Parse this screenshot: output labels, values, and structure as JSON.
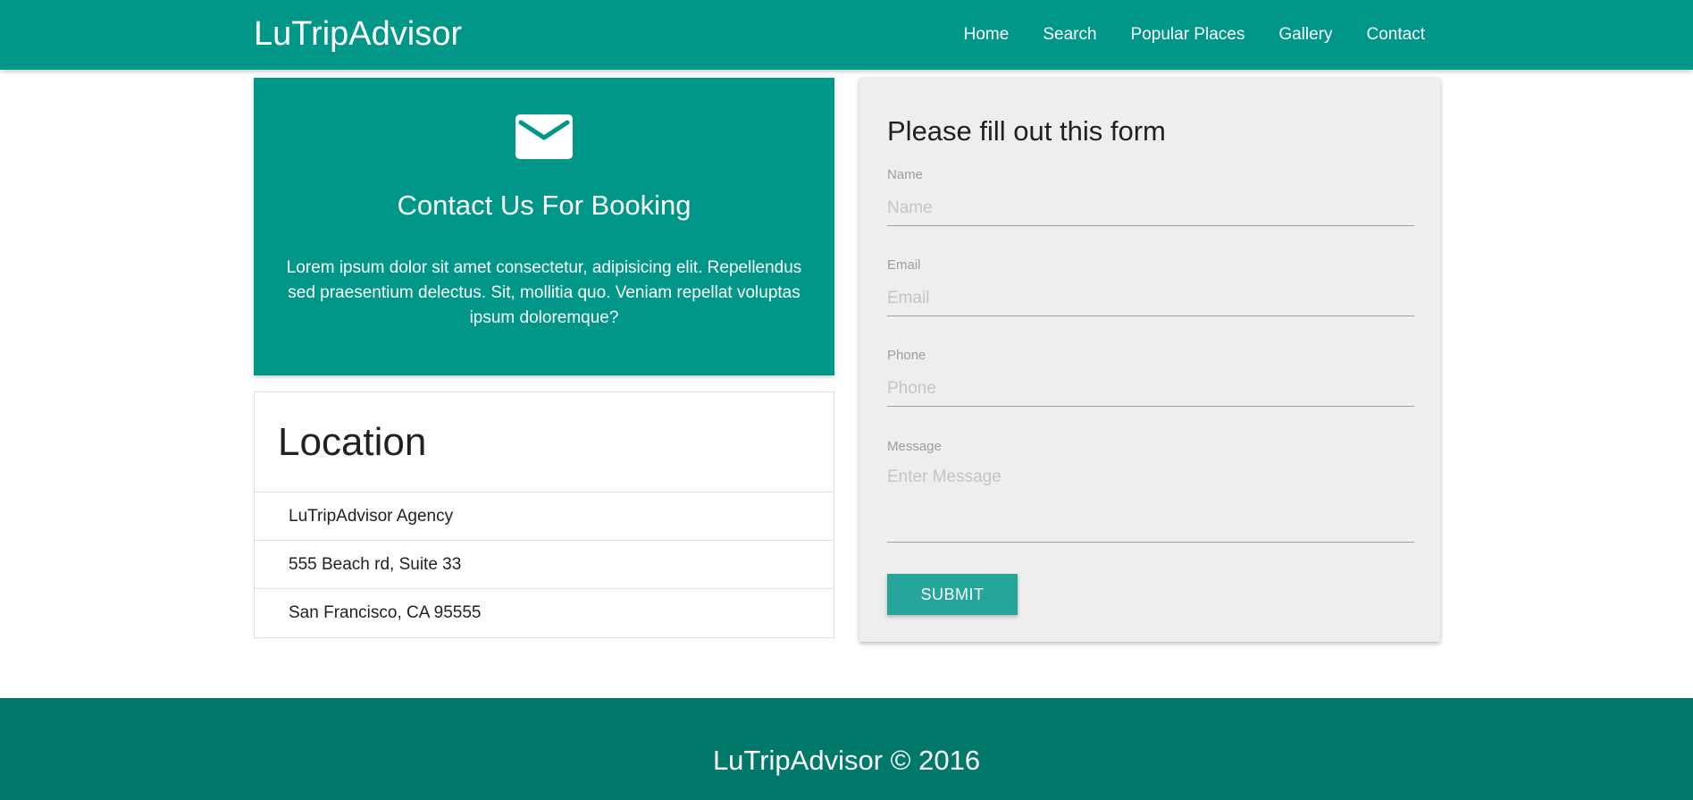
{
  "navbar": {
    "brand": "LuTripAdvisor",
    "links": [
      "Home",
      "Search",
      "Popular Places",
      "Gallery",
      "Contact"
    ]
  },
  "contact_card": {
    "icon": "envelope-icon",
    "title": "Contact Us For Booking",
    "text": "Lorem ipsum dolor sit amet consectetur, adipisicing elit. Repellendus sed praesentium delectus. Sit, mollitia quo. Veniam repellat voluptas ipsum doloremque?"
  },
  "location": {
    "title": "Location",
    "items": [
      "LuTripAdvisor Agency",
      "555 Beach rd, Suite 33",
      "San Francisco, CA 95555"
    ]
  },
  "form": {
    "title": "Please fill out this form",
    "fields": [
      {
        "label": "Name",
        "placeholder": "Name",
        "value": ""
      },
      {
        "label": "Email",
        "placeholder": "Email",
        "value": ""
      },
      {
        "label": "Phone",
        "placeholder": "Phone",
        "value": ""
      },
      {
        "label": "Message",
        "placeholder": "Enter Message",
        "value": ""
      }
    ],
    "submit_label": "SUBMIT"
  },
  "footer": {
    "text": "LuTripAdvisor © 2016"
  },
  "colors": {
    "primary": "#009688",
    "footer": "#00796b",
    "button": "#26a69a",
    "form_bg": "#eeeeee"
  }
}
